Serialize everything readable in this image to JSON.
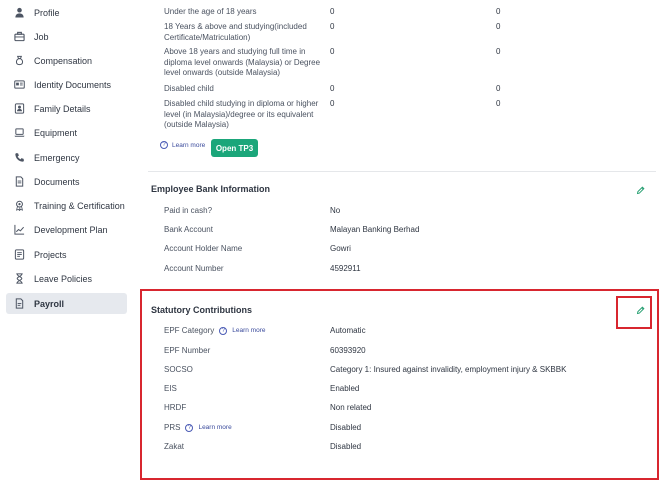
{
  "sidebar": {
    "items": [
      {
        "label": "Profile",
        "icon": "person-icon"
      },
      {
        "label": "Job",
        "icon": "briefcase-icon"
      },
      {
        "label": "Compensation",
        "icon": "money-bag-icon"
      },
      {
        "label": "Identity Documents",
        "icon": "id-card-icon"
      },
      {
        "label": "Family Details",
        "icon": "family-icon"
      },
      {
        "label": "Equipment",
        "icon": "laptop-icon"
      },
      {
        "label": "Emergency",
        "icon": "phone-icon"
      },
      {
        "label": "Documents",
        "icon": "document-icon"
      },
      {
        "label": "Training & Certification",
        "icon": "award-icon"
      },
      {
        "label": "Development Plan",
        "icon": "trend-chart-icon"
      },
      {
        "label": "Projects",
        "icon": "projects-icon"
      },
      {
        "label": "Leave Policies",
        "icon": "hourglass-icon"
      },
      {
        "label": "Payroll",
        "icon": "payroll-doc-icon",
        "active": true
      }
    ]
  },
  "tp3": {
    "rows": [
      {
        "label": "Under the age of 18 years",
        "v1": "0",
        "v2": "0"
      },
      {
        "label": "18 Years & above and studying(included Certificate/Matriculation)",
        "v1": "0",
        "v2": "0"
      },
      {
        "label": "Above 18 years and studying full time in diploma level onwards (Malaysia) or Degree level onwards (outside Malaysia)",
        "v1": "0",
        "v2": "0"
      },
      {
        "label": "Disabled child",
        "v1": "0",
        "v2": "0"
      },
      {
        "label": "Disabled child studying in diploma or higher level (in Malaysia)/degree or its equivalent (outside Malaysia)",
        "v1": "0",
        "v2": "0"
      }
    ],
    "learn_more": "Learn more",
    "open_button": "Open TP3"
  },
  "bank": {
    "title": "Employee Bank Information",
    "rows": [
      {
        "label": "Paid in cash?",
        "value": "No"
      },
      {
        "label": "Bank Account",
        "value": "Malayan Banking Berhad"
      },
      {
        "label": "Account Holder Name",
        "value": "Gowri"
      },
      {
        "label": "Account Number",
        "value": "4592911"
      }
    ]
  },
  "statutory": {
    "title": "Statutory Contributions",
    "rows": [
      {
        "label": "EPF Category",
        "value": "Automatic",
        "learn_more": "Learn more"
      },
      {
        "label": "EPF Number",
        "value": "60393920"
      },
      {
        "label": "SOCSO",
        "value": "Category 1: Insured against invalidity, employment injury & SKBBK"
      },
      {
        "label": "EIS",
        "value": "Enabled"
      },
      {
        "label": "HRDF",
        "value": "Non related"
      },
      {
        "label": "PRS",
        "value": "Disabled",
        "learn_more": "Learn more"
      },
      {
        "label": "Zakat",
        "value": "Disabled"
      }
    ]
  },
  "colors": {
    "accent": "#1ba67a",
    "highlight": "#d8262f",
    "link": "#3a4a9c"
  }
}
